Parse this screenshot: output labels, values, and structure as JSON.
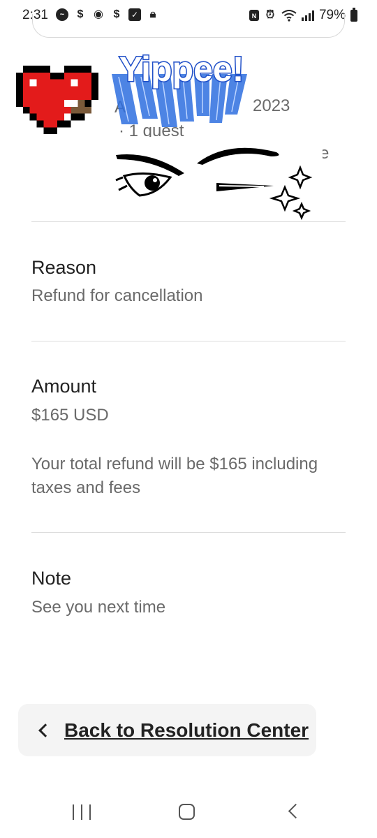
{
  "status_bar": {
    "time": "2:31",
    "left_icons": [
      "messenger-icon",
      "dollar-icon",
      "camera-alert-icon",
      "dollar-icon",
      "check-box-icon",
      "lock-icon"
    ],
    "battery_percent": "79%",
    "right_icons": [
      "nfc-icon",
      "alarm-icon",
      "wifi-icon",
      "signal-icon",
      "battery-icon"
    ]
  },
  "booking": {
    "date_fragment": "2023",
    "date_prefix_fragment": "A",
    "guests": "· 1 guest",
    "trailing_fragment": "e"
  },
  "stickers": {
    "yippee_text": "Yippee!"
  },
  "sections": {
    "reason": {
      "title": "Reason",
      "value": "Refund for cancellation"
    },
    "amount": {
      "title": "Amount",
      "value": "$165 USD",
      "note": "Your total refund will be $165 including taxes and fees"
    },
    "note": {
      "title": "Note",
      "value": "See you next time"
    }
  },
  "back_button": {
    "label": "Back to Resolution Center"
  },
  "nav_bar": {
    "icons": [
      "recents-icon",
      "home-icon",
      "back-icon"
    ]
  }
}
